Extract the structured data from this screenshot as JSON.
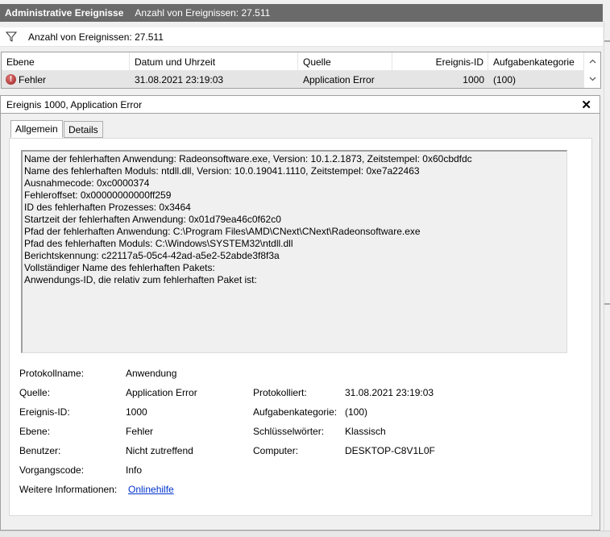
{
  "title_bar": {
    "title": "Administrative Ereignisse",
    "count_text": "Anzahl von Ereignissen: 27.511"
  },
  "filter_bar": {
    "text": "Anzahl von Ereignissen: 27.511",
    "icon": "filter-icon"
  },
  "grid": {
    "columns": [
      "Ebene",
      "Datum und Uhrzeit",
      "Quelle",
      "Ereignis-ID",
      "Aufgabenkategorie"
    ],
    "rows": [
      {
        "level": "Fehler",
        "datetime": "31.08.2021 23:19:03",
        "source": "Application Error",
        "event_id": "1000",
        "category": "(100)"
      }
    ]
  },
  "detail": {
    "header": "Ereignis 1000, Application Error",
    "tabs": [
      "Allgemein",
      "Details"
    ],
    "description_lines": [
      "Name der fehlerhaften Anwendung: Radeonsoftware.exe, Version: 10.1.2.1873, Zeitstempel: 0x60cbdfdc",
      "Name des fehlerhaften Moduls: ntdll.dll, Version: 10.0.19041.1110, Zeitstempel: 0xe7a22463",
      "Ausnahmecode: 0xc0000374",
      "Fehleroffset: 0x00000000000ff259",
      "ID des fehlerhaften Prozesses: 0x3464",
      "Startzeit der fehlerhaften Anwendung: 0x01d79ea46c0f62c0",
      "Pfad der fehlerhaften Anwendung: C:\\Program Files\\AMD\\CNext\\CNext\\Radeonsoftware.exe",
      "Pfad des fehlerhaften Moduls: C:\\Windows\\SYSTEM32\\ntdll.dll",
      "Berichtskennung: c22117a5-05c4-42ad-a5e2-52abde3f8f3a",
      "Vollständiger Name des fehlerhaften Pakets:",
      "Anwendungs-ID, die relativ zum fehlerhaften Paket ist:"
    ],
    "props": {
      "log_name_label": "Protokollname:",
      "log_name": "Anwendung",
      "source_label": "Quelle:",
      "source": "Application Error",
      "logged_label": "Protokolliert:",
      "logged": "31.08.2021 23:19:03",
      "event_id_label": "Ereignis-ID:",
      "event_id": "1000",
      "task_label": "Aufgabenkategorie:",
      "task": "(100)",
      "level_label": "Ebene:",
      "level": "Fehler",
      "keywords_label": "Schlüsselwörter:",
      "keywords": "Klassisch",
      "user_label": "Benutzer:",
      "user": "Nicht zutreffend",
      "computer_label": "Computer:",
      "computer": "DESKTOP-C8V1L0F",
      "opcode_label": "Vorgangscode:",
      "opcode": "Info",
      "more_info_label": "Weitere Informationen:",
      "more_info_link": "Onlinehilfe"
    }
  },
  "colors": {
    "title_bg": "#6a6a6a",
    "selected_row": "#e5e5e5",
    "link": "#0033cc",
    "error": "#9b1d1d"
  }
}
